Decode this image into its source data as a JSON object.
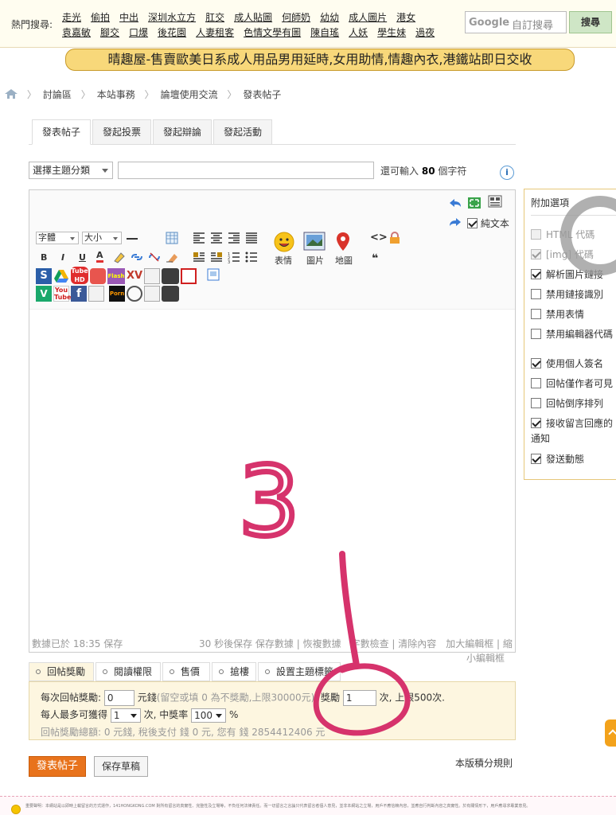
{
  "header": {
    "hot_label": "熱門搜尋:",
    "hot_row1": [
      "走光",
      "偷拍",
      "中出",
      "深圳水立方",
      "肛交",
      "成人貼圖",
      "何師奶",
      "幼幼",
      "成人圖片",
      "港女"
    ],
    "hot_row2": [
      "袁嘉敏",
      "腳交",
      "口爆",
      "後花園",
      "人妻租客",
      "色情文學有圖",
      "陳自瑤",
      "人妖",
      "學生妹",
      "過夜"
    ],
    "search_placeholder": "自訂搜尋",
    "search_brand": "Google",
    "search_button": "搜尋"
  },
  "banner": {
    "text": "晴趣屋-售賣歐美日系成人用品男用延時,女用助情,情趣內衣,港鐵站即日交收"
  },
  "breadcrumb": [
    "討論區",
    "本站事務",
    "論壇使用交流",
    "發表帖子"
  ],
  "tabs": [
    "發表帖子",
    "發起投票",
    "發起辯論",
    "發起活動"
  ],
  "subject": {
    "category_placeholder": "選擇主題分類",
    "note_prefix": "還可輸入",
    "note_count": "80",
    "note_suffix": "個字符"
  },
  "editor": {
    "font_label": "字體",
    "size_label": "大小",
    "emoji_label": "表情",
    "image_label": "圖片",
    "map_label": "地圖",
    "plain_text_label": "純文本",
    "plain_text_checked": true,
    "status_left": "數據已於 18:35 保存",
    "status_right": "30 秒後保存 保存數據 | 恢複數據　字數檢查 | 清除內容　加大編輯框 | 縮",
    "status_right2": "小編輯框"
  },
  "options": {
    "title": "附加選項",
    "items": [
      {
        "label": "HTML 代碼",
        "checked": false,
        "disabled": true
      },
      {
        "label": "[img] 代碼",
        "checked": true,
        "disabled": true
      },
      {
        "label": "解析圖片鏈接",
        "checked": true,
        "disabled": false
      },
      {
        "label": "禁用鏈接識別",
        "checked": false,
        "disabled": false
      },
      {
        "label": "禁用表情",
        "checked": false,
        "disabled": false
      },
      {
        "label": "禁用編輯器代碼",
        "checked": false,
        "disabled": false
      },
      {
        "label": "使用個人簽名",
        "checked": true,
        "disabled": false
      },
      {
        "label": "回帖僅作者可見",
        "checked": false,
        "disabled": false
      },
      {
        "label": "回帖倒序排列",
        "checked": false,
        "disabled": false
      },
      {
        "label": "接收留言回應的",
        "checked": true,
        "disabled": false
      },
      {
        "label": "通知",
        "checked": false,
        "disabled": false
      },
      {
        "label": "發送動態",
        "checked": true,
        "disabled": false
      }
    ]
  },
  "bottom_tabs": [
    "回帖獎勵",
    "閱讀權限",
    "售價",
    "搶樓",
    "設置主題標籤"
  ],
  "reward": {
    "row1_label": "每次回帖獎勵:",
    "row1_value": "0",
    "row1_unit": "元錢",
    "row1_hint": "(留空或填 0 為不獎勵,上限30000元)",
    "row1_mid": ", 獎勵",
    "row1_count": "1",
    "row1_suffix": "次, 上限500次.",
    "row2_label": "每人最多可獲得",
    "row2_value": "1",
    "row2_mid": "次, 中獎率",
    "row2_rate": "100",
    "row2_suffix": "%",
    "row3": "回帖獎勵總額: 0 元錢, 稅後支付 錢 0 元, 您有 錢 2854412406 元"
  },
  "actions": {
    "submit": "發表帖子",
    "draft": "保存草稿",
    "rules": "本版積分規則"
  },
  "footer": {
    "text": "重要聲明：本網站是以即時上載留言的方式運作，141HONGKONG.COM 對所有留言的真實性、完整性及立場等，不負任何法律責任。而一切留言之言論只代表留言者個人意見，並非本網站之立場，用戶不應信賴內容，並應自行判斷內容之真實性。於有關情形下，用戶應尋求專業意見。"
  },
  "colors": {
    "accent": "#e8731c",
    "banner": "#f8d87a",
    "annotation": "#d6336c"
  },
  "annotation_text": "3"
}
